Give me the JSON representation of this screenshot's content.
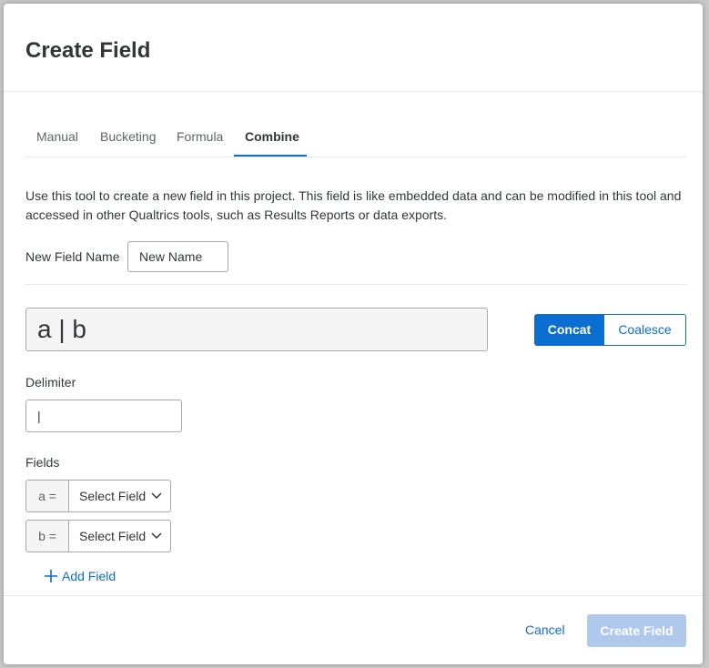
{
  "dialog": {
    "title": "Create Field",
    "tabs": [
      {
        "label": "Manual",
        "active": false
      },
      {
        "label": "Bucketing",
        "active": false
      },
      {
        "label": "Formula",
        "active": false
      },
      {
        "label": "Combine",
        "active": true
      }
    ],
    "description": "Use this tool to create a new field in this project. This field is like embedded data and can be modified in this tool and accessed in other Qualtrics tools, such as Results Reports or data exports.",
    "new_field_name_label": "New Field Name",
    "new_field_name_value": "New Name",
    "formula_preview": "a | b",
    "mode": {
      "options": [
        "Concat",
        "Coalesce"
      ],
      "selected": "Concat"
    },
    "delimiter_label": "Delimiter",
    "delimiter_value": "|",
    "fields_label": "Fields",
    "fields": [
      {
        "prefix": "a =",
        "select_value": "Select Field"
      },
      {
        "prefix": "b =",
        "select_value": "Select Field"
      }
    ],
    "add_field_label": "Add Field",
    "cancel_label": "Cancel",
    "create_label": "Create Field"
  },
  "colors": {
    "accent": "#0b6ed0",
    "disabled_button": "#aec9ec"
  },
  "icons": [
    "chevron-down-icon",
    "plus-icon"
  ]
}
